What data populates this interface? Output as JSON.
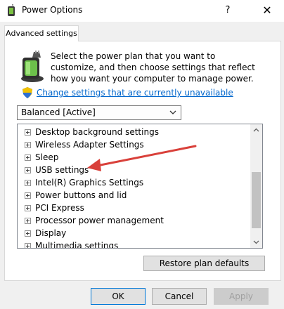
{
  "window": {
    "title": "Power Options",
    "help_glyph": "?",
    "close_glyph": "✕",
    "icon": "power-options-icon"
  },
  "tab": {
    "label": "Advanced settings"
  },
  "description": "Select the power plan that you want to customize, and then choose settings that reflect how you want your computer to manage power.",
  "change_link": "Change settings that are currently unavailable",
  "plan_select": {
    "value": "Balanced [Active]"
  },
  "tree_items": [
    "Desktop background settings",
    "Wireless Adapter Settings",
    "Sleep",
    "USB settings",
    "Intel(R) Graphics Settings",
    "Power buttons and lid",
    "PCI Express",
    "Processor power management",
    "Display",
    "Multimedia settings"
  ],
  "buttons": {
    "restore": "Restore plan defaults",
    "ok": "OK",
    "cancel": "Cancel",
    "apply": "Apply"
  },
  "colors": {
    "link": "#0066cc",
    "annotation_arrow": "#d9403a"
  }
}
